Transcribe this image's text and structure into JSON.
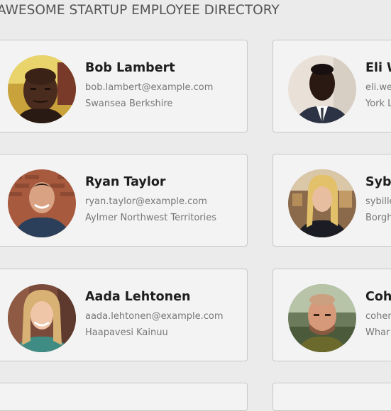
{
  "header": {
    "title": "AWESOME STARTUP EMPLOYEE DIRECTORY"
  },
  "employees": [
    {
      "name": "Bob Lambert",
      "email": "bob.lambert@example.com",
      "location": "Swansea Berkshire",
      "avatar_icon": "man-portrait-photo"
    },
    {
      "name": "Eli W",
      "email": "eli.we",
      "location": "York L",
      "avatar_icon": "man-in-suit-portrait-photo"
    },
    {
      "name": "Ryan Taylor",
      "email": "ryan.taylor@example.com",
      "location": "Aylmer Northwest Territories",
      "avatar_icon": "man-smiling-portrait-photo"
    },
    {
      "name": "Sybi",
      "email": "sybille",
      "location": "Borgh",
      "avatar_icon": "woman-blonde-portrait-photo"
    },
    {
      "name": "Aada Lehtonen",
      "email": "aada.lehtonen@example.com",
      "location": "Haapavesi Kainuu",
      "avatar_icon": "woman-smiling-portrait-photo"
    },
    {
      "name": "Cohe",
      "email": "cohen",
      "location": "Whar",
      "avatar_icon": "bald-man-portrait-photo"
    }
  ]
}
